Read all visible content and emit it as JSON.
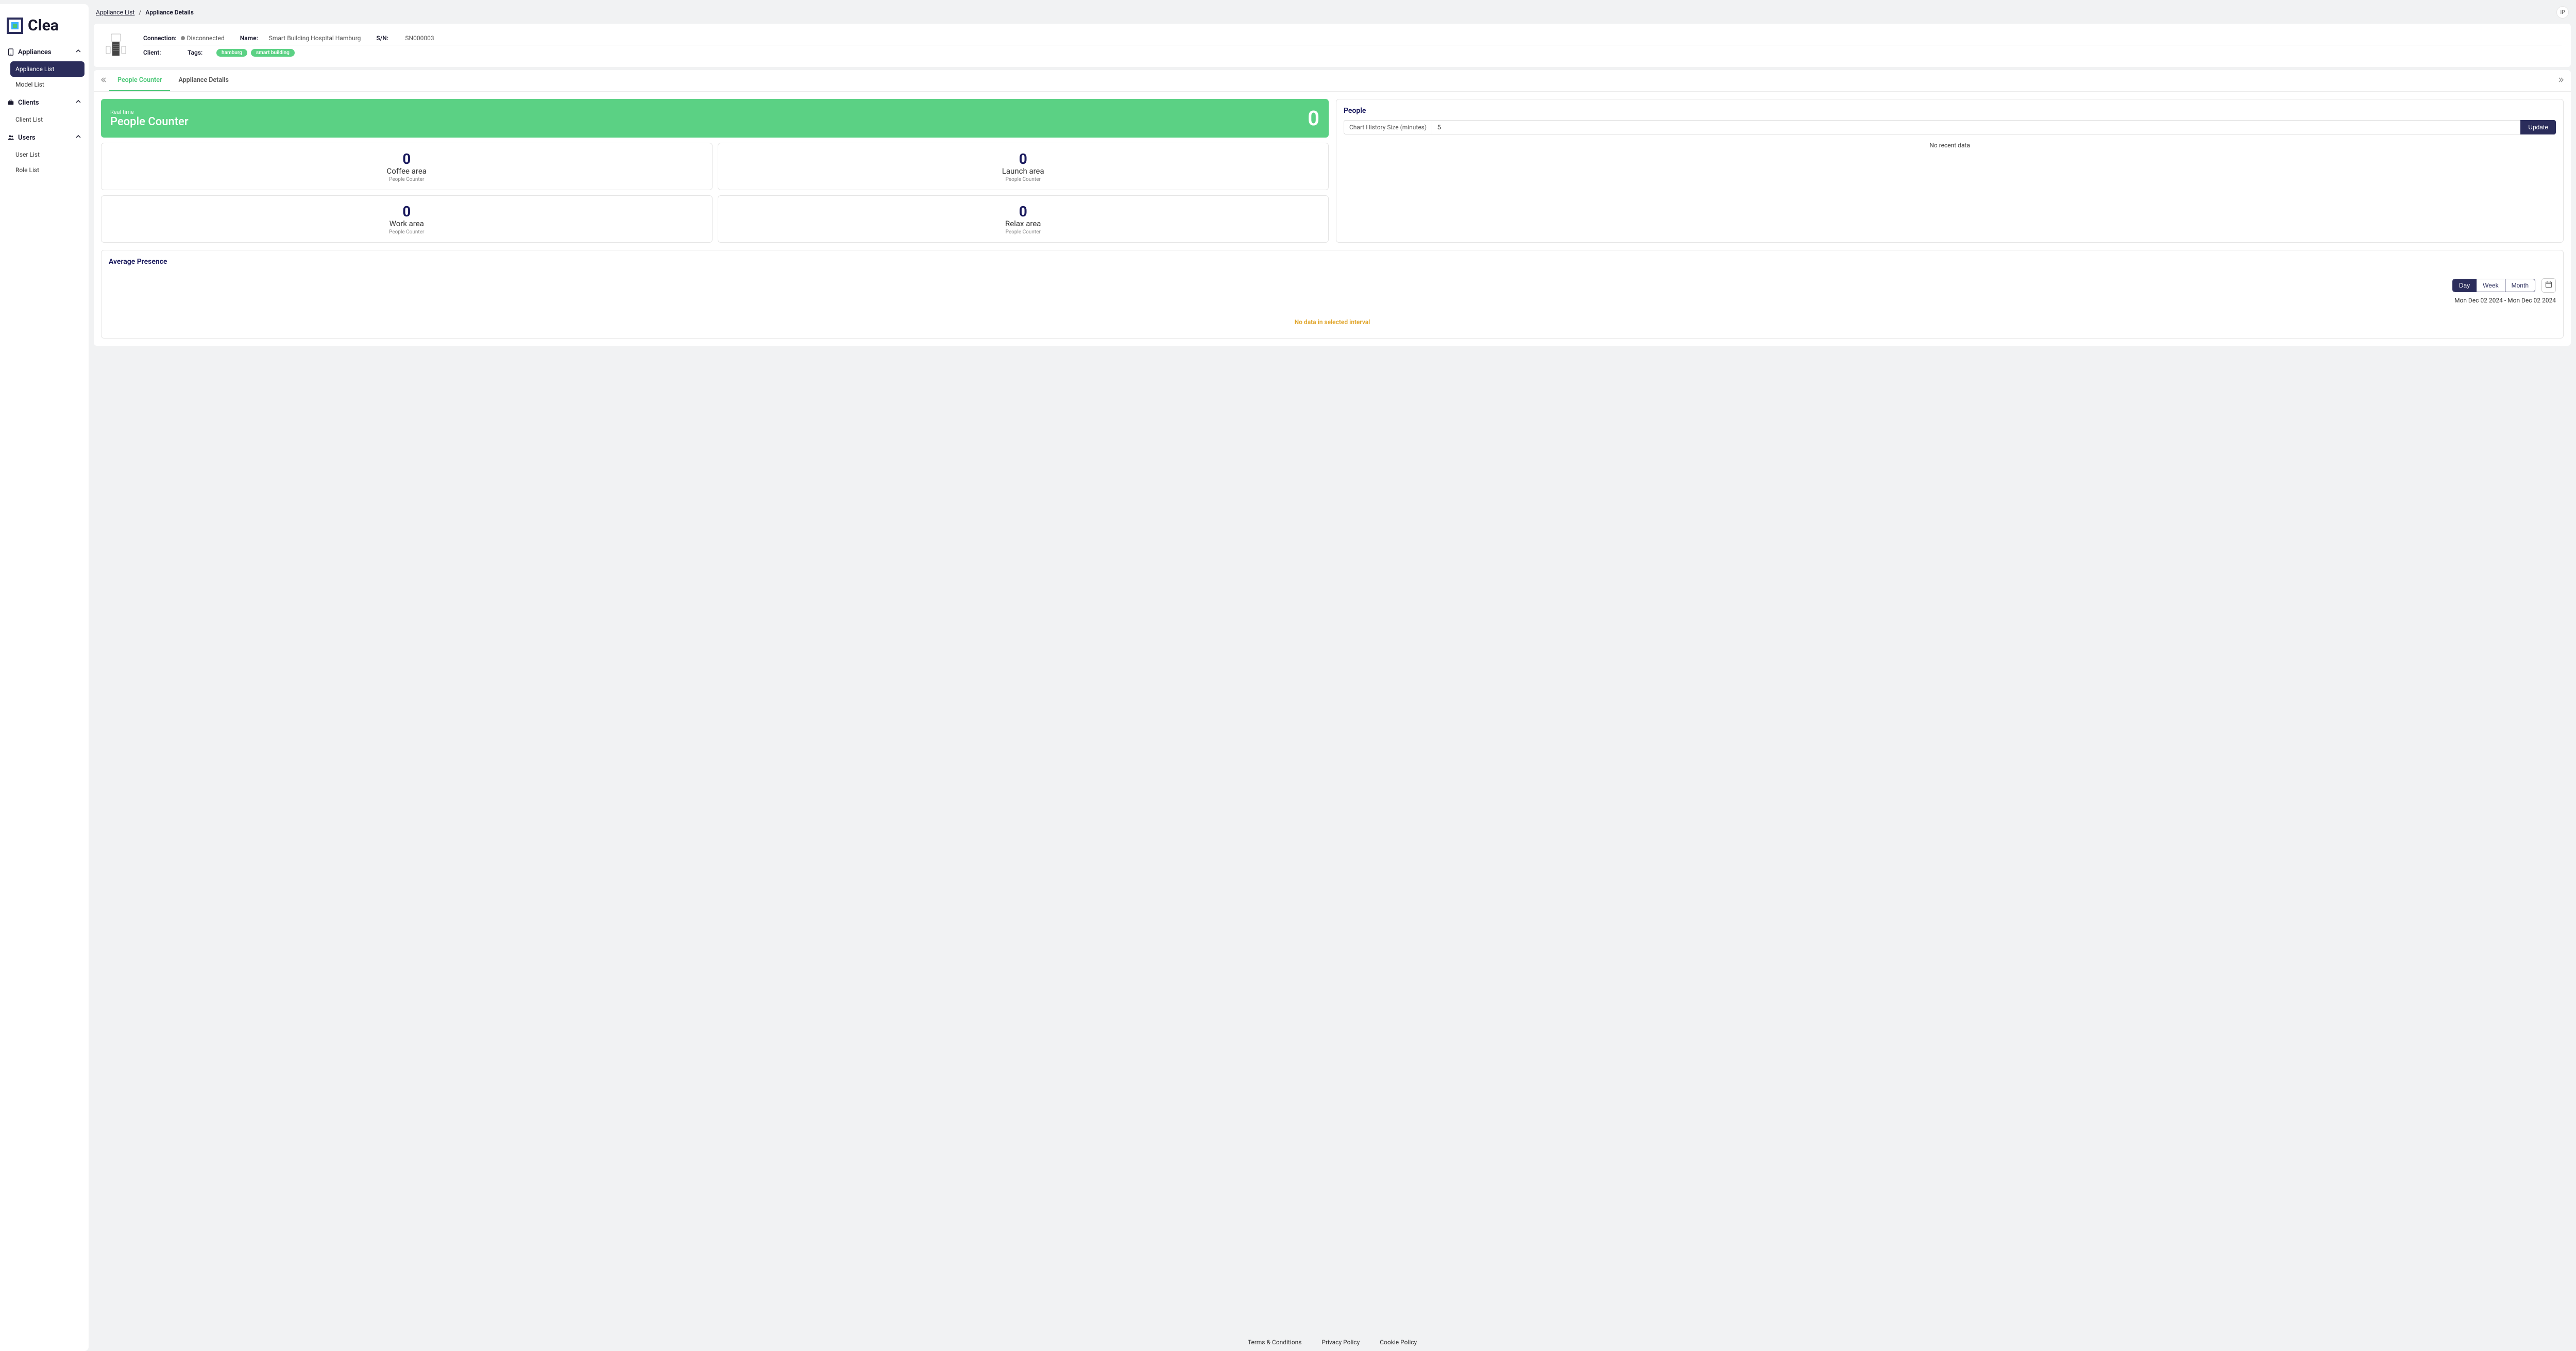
{
  "brand": {
    "name": "Clea"
  },
  "sidebar": {
    "groups": [
      {
        "id": "appliances",
        "label": "Appliances",
        "items": [
          {
            "id": "appliance-list",
            "label": "Appliance List",
            "active": true
          },
          {
            "id": "model-list",
            "label": "Model List"
          }
        ]
      },
      {
        "id": "clients",
        "label": "Clients",
        "items": [
          {
            "id": "client-list",
            "label": "Client List"
          }
        ]
      },
      {
        "id": "users",
        "label": "Users",
        "items": [
          {
            "id": "user-list",
            "label": "User List"
          },
          {
            "id": "role-list",
            "label": "Role List"
          }
        ]
      }
    ]
  },
  "breadcrumb": {
    "link": "Appliance List",
    "sep": "/",
    "current": "Appliance Details"
  },
  "user": {
    "initials": "IP"
  },
  "appliance": {
    "connection_label": "Connection:",
    "connection_value": "Disconnected",
    "name_label": "Name:",
    "name_value": "Smart Building Hospital Hamburg",
    "sn_label": "S/N:",
    "sn_value": "SN000003",
    "client_label": "Client:",
    "client_value": "",
    "tags_label": "Tags:",
    "tags": [
      "hamburg",
      "smart building"
    ]
  },
  "tabs": {
    "items": [
      {
        "id": "people-counter",
        "label": "People Counter",
        "active": true
      },
      {
        "id": "appliance-details",
        "label": "Appliance Details"
      }
    ]
  },
  "hero": {
    "subtitle": "Real time",
    "title": "People Counter",
    "value": "0"
  },
  "areas": [
    {
      "value": "0",
      "name": "Coffee area",
      "caption": "People Counter"
    },
    {
      "value": "0",
      "name": "Launch area",
      "caption": "People Counter"
    },
    {
      "value": "0",
      "name": "Work area",
      "caption": "People Counter"
    },
    {
      "value": "0",
      "name": "Relax area",
      "caption": "People Counter"
    }
  ],
  "people_chart": {
    "title": "People",
    "input_label": "Chart History Size (minutes)",
    "input_value": "5",
    "update_label": "Update",
    "empty": "No recent data"
  },
  "avg": {
    "title": "Average Presence",
    "segments": {
      "day": "Day",
      "week": "Week",
      "month": "Month",
      "active": "day"
    },
    "date_range": "Mon Dec 02 2024 - Mon Dec 02 2024",
    "empty": "No data in selected interval"
  },
  "footer": {
    "terms": "Terms & Conditions",
    "privacy": "Privacy Policy",
    "cookie": "Cookie Policy"
  },
  "chart_data": {
    "type": "bar",
    "categories": [
      "Coffee area",
      "Launch area",
      "Work area",
      "Relax area"
    ],
    "values": [
      0,
      0,
      0,
      0
    ],
    "title": "Real time People Counter",
    "xlabel": "",
    "ylabel": "People",
    "ylim": [
      0,
      1
    ]
  }
}
